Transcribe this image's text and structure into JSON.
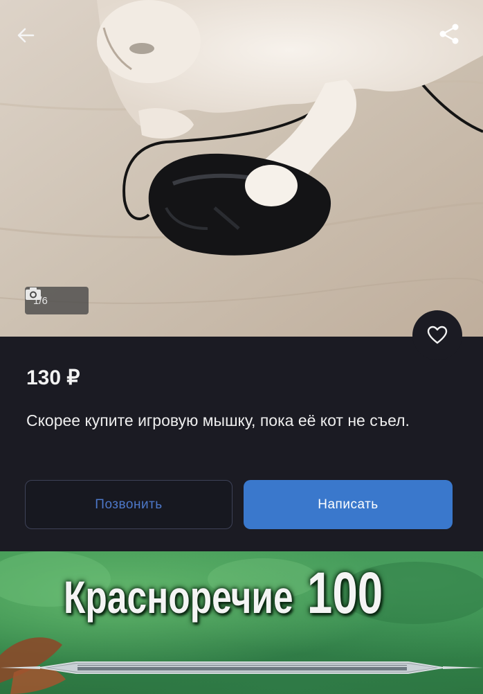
{
  "photo": {
    "counter": "1/6",
    "back_icon": "arrow-left-icon",
    "share_icon": "share-icon",
    "camera_icon": "camera-icon"
  },
  "listing": {
    "price": "130 ₽",
    "description": "Скорее купите игровую мышку, пока её кот не съел.",
    "favorite_icon": "heart-icon",
    "call_label": "Позвонить",
    "write_label": "Написать"
  },
  "banner": {
    "skill_name": "Красноречие",
    "skill_level": "100"
  },
  "colors": {
    "panel_bg": "#1b1b23",
    "accent": "#3a78cc",
    "banner_green": "#3e9452"
  }
}
